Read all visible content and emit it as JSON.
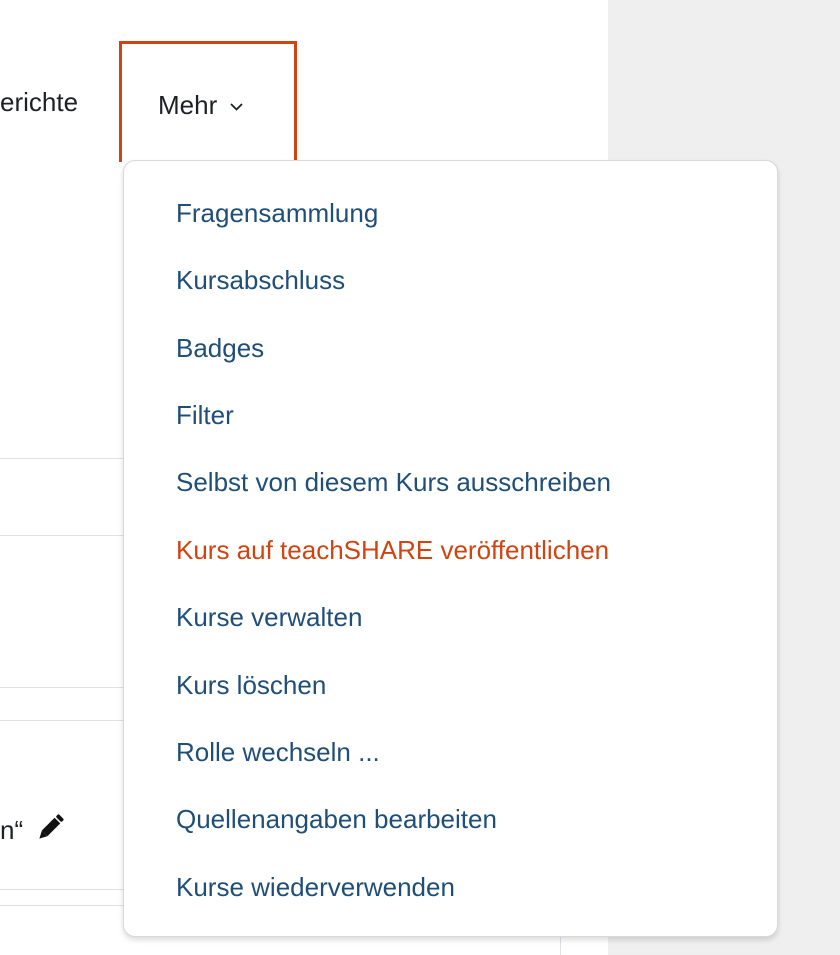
{
  "nav": {
    "reports_tab_fragment": "erichte",
    "more_tab_label": "Mehr"
  },
  "content": {
    "row_text_fragment": "n“"
  },
  "menu": {
    "items": [
      {
        "label": "Fragensammlung"
      },
      {
        "label": "Kursabschluss"
      },
      {
        "label": "Badges"
      },
      {
        "label": "Filter"
      },
      {
        "label": "Selbst von diesem Kurs ausschreiben"
      },
      {
        "label": "Kurs auf teachSHARE veröffentlichen",
        "active": true
      },
      {
        "label": "Kurse verwalten"
      },
      {
        "label": "Kurs löschen"
      },
      {
        "label": "Rolle wechseln ..."
      },
      {
        "label": "Quellenangaben bearbeiten"
      },
      {
        "label": "Kurse wiederverwenden"
      }
    ]
  },
  "colors": {
    "accent": "#cf4411",
    "link": "#1f4e79",
    "text": "#1d2125",
    "right_panel_bg": "#efefef"
  },
  "icons": {
    "dropdown_caret": "chevron-down-icon",
    "edit": "pencil-icon"
  }
}
